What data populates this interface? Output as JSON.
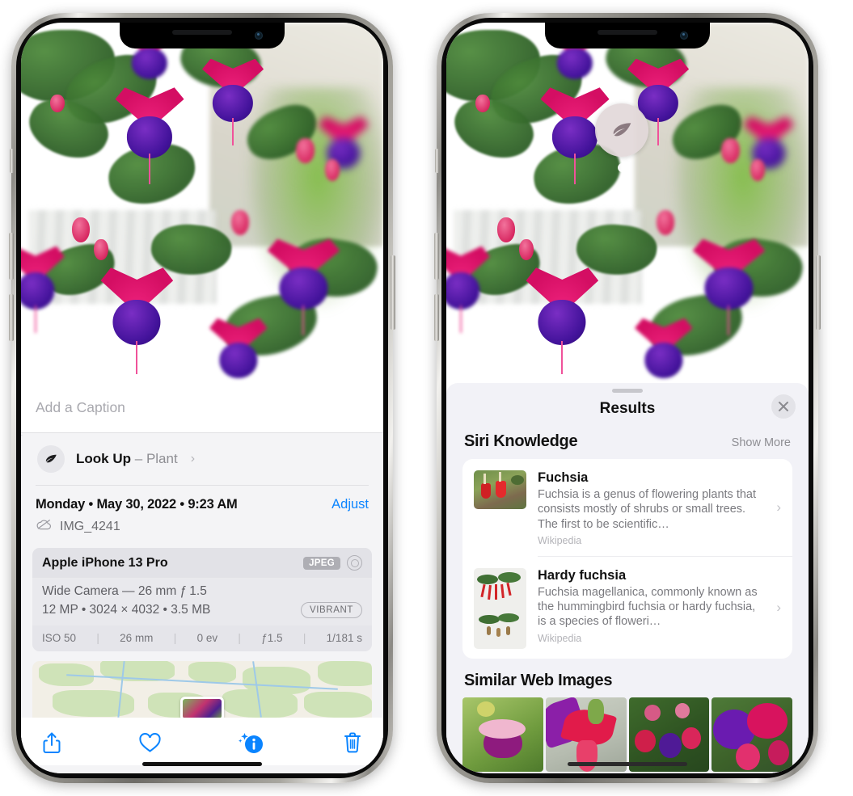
{
  "scene": {
    "device_name": "iPhone 13 Pro",
    "left_screen_label": "Photos detail view with Visual Look Up row",
    "right_screen_label": "Visual Look Up Results sheet"
  },
  "left_phone": {
    "caption": {
      "placeholder": "Add a Caption",
      "value": ""
    },
    "look_up": {
      "icon": "leaf-icon",
      "label": "Look Up",
      "separator": "–",
      "subject": "Plant",
      "chevron": "›"
    },
    "meta": {
      "date_line": "Monday • May 30, 2022 • 9:23 AM",
      "adjust_label": "Adjust",
      "cloud_icon": "cloud-slash-icon",
      "filename": "IMG_4241"
    },
    "exif": {
      "device": "Apple iPhone 13 Pro",
      "format_badge": "JPEG",
      "hdr_icon": "aperture-icon",
      "lens_line": "Wide Camera — 26 mm ƒ 1.5",
      "size_line": "12 MP • 3024 × 4032 • 3.5 MB",
      "style_pill": "VIBRANT",
      "stats": [
        "ISO 50",
        "26 mm",
        "0 ev",
        "ƒ1.5",
        "1/181 s"
      ],
      "stat_separator": "|"
    },
    "map": {
      "label": "photo-location-map",
      "pin": "photo-pin-thumbnail"
    },
    "toolbar": [
      {
        "name": "share-button",
        "icon": "share-icon"
      },
      {
        "name": "favorite-button",
        "icon": "heart-icon"
      },
      {
        "name": "info-button",
        "icon": "info-sparkle-icon"
      },
      {
        "name": "delete-button",
        "icon": "trash-icon"
      }
    ],
    "accent_color": "#0a84ff"
  },
  "right_phone": {
    "photo_badge": {
      "icon": "leaf-icon",
      "name": "visual-look-up-badge"
    },
    "sheet": {
      "grabber": "sheet-grabber",
      "title": "Results",
      "close_icon": "close-icon"
    },
    "siri_knowledge": {
      "title": "Siri Knowledge",
      "show_more": "Show More",
      "cards": [
        {
          "title": "Fuchsia",
          "description": "Fuchsia is a genus of flowering plants that consists mostly of shrubs or small trees. The first to be scientific…",
          "source": "Wikipedia",
          "thumb": "fuchsia-red-flowers-thumbnail",
          "chevron": "›"
        },
        {
          "title": "Hardy fuchsia",
          "description": "Fuchsia magellanica, commonly known as the hummingbird fuchsia or hardy fuchsia, is a species of floweri…",
          "source": "Wikipedia",
          "thumb": "hardy-fuchsia-specimen-thumbnail",
          "chevron": "›"
        }
      ]
    },
    "similar_web_images": {
      "title": "Similar Web Images",
      "images": [
        "fuchsia-pink-white-bloom",
        "fuchsia-red-closeup",
        "fuchsia-hedge-red-purple",
        "fuchsia-purple-magenta-cluster"
      ]
    }
  }
}
